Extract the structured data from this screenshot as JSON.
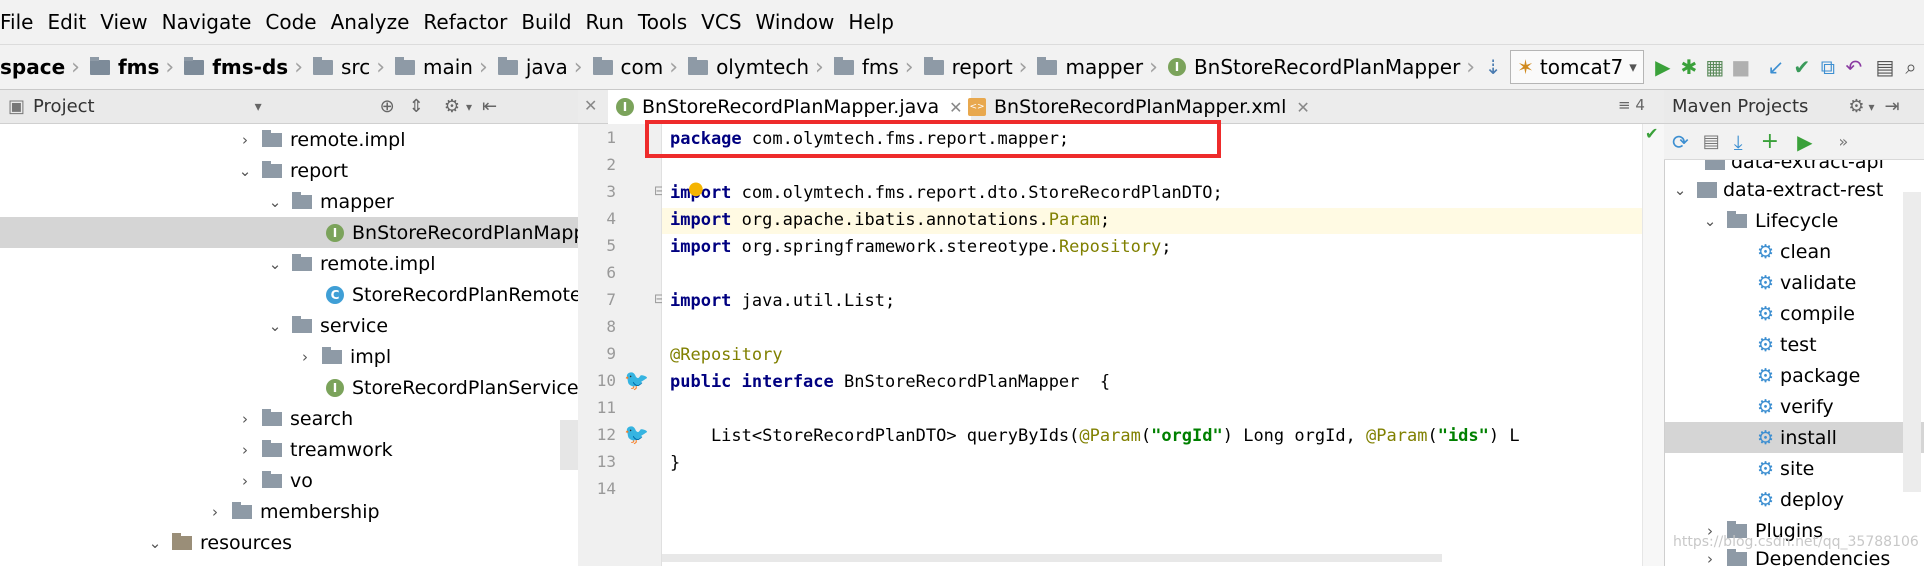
{
  "menu": [
    "File",
    "Edit",
    "View",
    "Navigate",
    "Code",
    "Analyze",
    "Refactor",
    "Build",
    "Run",
    "Tools",
    "VCS",
    "Window",
    "Help"
  ],
  "breadcrumbs": [
    "space",
    "fms",
    "fms-ds",
    "src",
    "main",
    "java",
    "com",
    "olymtech",
    "fms",
    "report",
    "mapper",
    "BnStoreRecordPlanMapper"
  ],
  "run_config": "tomcat7",
  "project_panel": {
    "title": "Project"
  },
  "tree": [
    {
      "label": "remote.impl",
      "type": "folder",
      "expanded": false
    },
    {
      "label": "report",
      "type": "folder",
      "expanded": true
    },
    {
      "label": "mapper",
      "type": "folder",
      "expanded": true
    },
    {
      "label": "BnStoreRecordPlanMapp",
      "type": "interface",
      "selected": true
    },
    {
      "label": "remote.impl",
      "type": "folder",
      "expanded": true
    },
    {
      "label": "StoreRecordPlanRemoteI",
      "type": "class"
    },
    {
      "label": "service",
      "type": "folder",
      "expanded": true
    },
    {
      "label": "impl",
      "type": "folder",
      "expanded": false
    },
    {
      "label": "StoreRecordPlanService",
      "type": "interface"
    },
    {
      "label": "search",
      "type": "folder",
      "expanded": false
    },
    {
      "label": "treamwork",
      "type": "folder",
      "expanded": false
    },
    {
      "label": "vo",
      "type": "folder",
      "expanded": false
    },
    {
      "label": "membership",
      "type": "folder",
      "expanded": false
    },
    {
      "label": "resources",
      "type": "resources",
      "expanded": true
    }
  ],
  "tabs": [
    {
      "label": "BnStoreRecordPlanMapper.java",
      "active": true
    },
    {
      "label": "BnStoreRecordPlanMapper.xml",
      "active": false
    }
  ],
  "tabs_extra": "≡ 4",
  "line_numbers": [
    "1",
    "2",
    "3",
    "4",
    "5",
    "6",
    "7",
    "8",
    "9",
    "10",
    "11",
    "12",
    "13",
    "14"
  ],
  "code": {
    "l1_kw": "package",
    "l1_rest": " com.olymtech.fms.report.mapper;",
    "l3_kw": "import",
    "l3_rest": " com.olymtech.fms.report.dto.StoreRecordPlanDTO;",
    "l4_kw": "import",
    "l4_rest_a": " org.apache.ibatis.annotations.",
    "l4_rest_b": "Param",
    "l4_rest_c": ";",
    "l5_kw": "import",
    "l5_rest_a": " org.springframework.stereotype.",
    "l5_rest_b": "Repository",
    "l5_rest_c": ";",
    "l7_kw": "import",
    "l7_rest": " java.util.List;",
    "l9_ann": "@Repository",
    "l10_kw": "public interface",
    "l10_rest": " BnStoreRecordPlanMapper  {",
    "l12_a": "    List<StoreRecordPlanDTO> queryByIds(",
    "l12_ann1": "@Param",
    "l12_b": "(",
    "l12_str1": "\"orgId\"",
    "l12_c": ") Long orgId, ",
    "l12_ann2": "@Param",
    "l12_d": "(",
    "l12_str2": "\"ids\"",
    "l12_e": ") L",
    "l13": "}"
  },
  "maven_panel": {
    "title": "Maven Projects"
  },
  "maven_tree": [
    {
      "label": "data-extract-api",
      "type": "module"
    },
    {
      "label": "data-extract-rest",
      "type": "module",
      "expanded": true
    },
    {
      "label": "Lifecycle",
      "type": "folder",
      "expanded": true
    },
    {
      "label": "clean",
      "type": "goal"
    },
    {
      "label": "validate",
      "type": "goal"
    },
    {
      "label": "compile",
      "type": "goal"
    },
    {
      "label": "test",
      "type": "goal"
    },
    {
      "label": "package",
      "type": "goal"
    },
    {
      "label": "verify",
      "type": "goal"
    },
    {
      "label": "install",
      "type": "goal",
      "selected": true
    },
    {
      "label": "site",
      "type": "goal"
    },
    {
      "label": "deploy",
      "type": "goal"
    },
    {
      "label": "Plugins",
      "type": "folder",
      "expanded": false
    },
    {
      "label": "Dependencies",
      "type": "folder",
      "expanded": false
    }
  ],
  "watermark": "https://blog.csdn.net/qq_35788106",
  "colors": {
    "highlight_box": "#ee2b2b",
    "keyword": "#000080",
    "annotation": "#808000",
    "string": "#008000",
    "selection": "#d5d5d5"
  }
}
